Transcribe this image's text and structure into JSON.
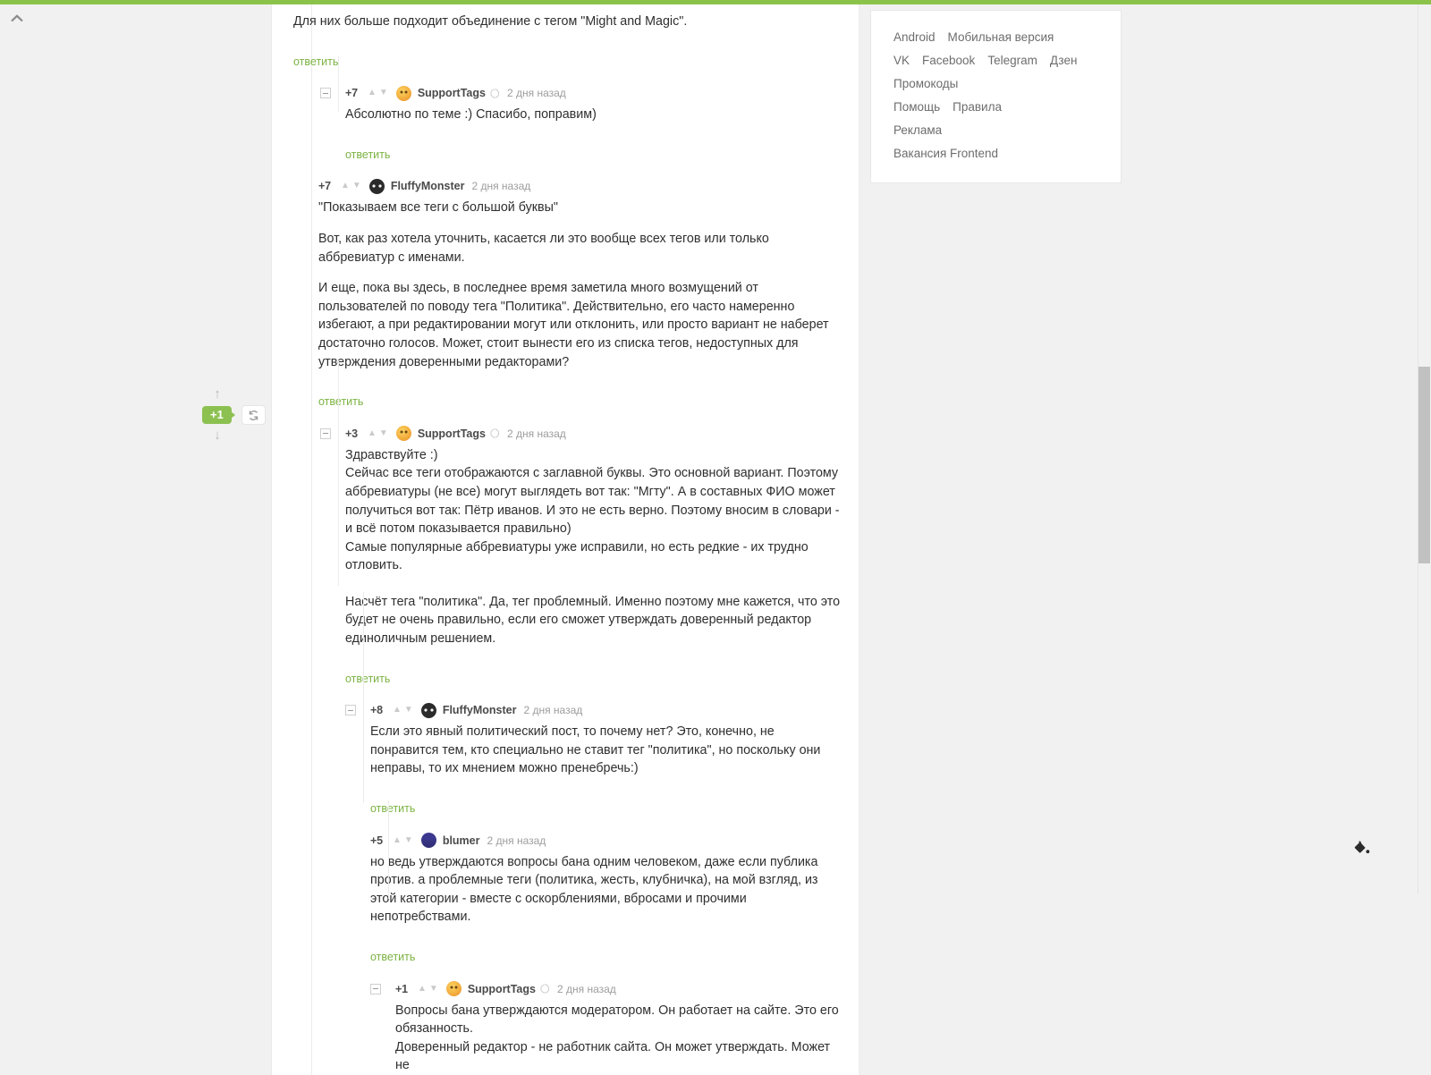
{
  "theme": {
    "accent_green": "#8bc34a",
    "link_green": "#7cb342",
    "page_bg": "#f1f1f1",
    "panel_bg": "#ffffff"
  },
  "float_vote": {
    "score": "+1",
    "up_arrow": "↑",
    "down_arrow": "↓"
  },
  "labels": {
    "reply": "ответить",
    "collapse": "–"
  },
  "comments": [
    {
      "id": "c0",
      "indent": 0,
      "show_head": false,
      "paragraphs": [
        "Для них больше подходит объединение с тегом \"Might and Magic\"."
      ],
      "reply": "ответить"
    },
    {
      "id": "c1",
      "indent": 1,
      "show_head": true,
      "collapser": true,
      "score": "+7",
      "author": "SupportTags",
      "avatar": "supporttags",
      "badge": "moon-badge",
      "time": "2 дня назад",
      "paragraphs": [
        "Абсолютно по теме :) Спасибо, поправим)"
      ],
      "reply": "ответить"
    },
    {
      "id": "c2",
      "indent": 0,
      "show_head": true,
      "collapser": false,
      "score": "+7",
      "author": "FluffyMonster",
      "avatar": "fluffymonster",
      "time": "2 дня назад",
      "paragraphs": [
        "\"Показываем все теги с большой буквы\"",
        "Вот, как раз хотела уточнить, касается ли это вообще всех тегов или только аббревиатур с именами.",
        "И еще, пока вы здесь, в последнее время заметила много возмущений от пользователей по поводу тега \"Политика\". Действительно, его часто намеренно избегают, а при редактировании могут или отклонить, или просто вариант не наберет достаточно голосов. Может, стоит вынести его из списка тегов, недоступных для утверждения доверенными редакторами?"
      ],
      "reply": "ответить"
    },
    {
      "id": "c3",
      "indent": 1,
      "show_head": true,
      "collapser": true,
      "score": "+3",
      "author": "SupportTags",
      "avatar": "supporttags",
      "badge": "moon-badge",
      "time": "2 дня назад",
      "tight_block": [
        "Здравствуйте :)",
        "Сейчас все теги отображаются с заглавной буквы. Это основной вариант. Поэтому аббревиатуры (не все) могут выглядеть вот так: \"Мгту\". А в составных ФИО может получиться вот так: Пётр иванов. И это не есть верно. Поэтому вносим в словари - и всё потом показывается правильно)",
        "Самые популярные аббревиатуры уже исправили, но есть редкие - их трудно отловить."
      ],
      "paragraphs": [
        "Насчёт тега \"политика\". Да, тег проблемный. Именно поэтому мне  кажется, что это будет не очень правильно, если его сможет утверждать доверенный редактор единоличным решением."
      ],
      "reply": "ответить"
    },
    {
      "id": "c4",
      "indent": 2,
      "show_head": true,
      "collapser": true,
      "score": "+8",
      "author": "FluffyMonster",
      "avatar": "fluffymonster",
      "time": "2 дня назад",
      "paragraphs": [
        "Если это явный политический пост, то почему нет? Это, конечно, не понравится тем, кто специально не ставит тег \"политика\", но поскольку они неправы, то их мнением можно пренебречь:)"
      ],
      "reply": "ответить"
    },
    {
      "id": "c5",
      "indent": 2,
      "show_head": true,
      "collapser": false,
      "score": "+5",
      "author": "blumer",
      "avatar": "blumer",
      "time": "2 дня назад",
      "paragraphs": [
        "но ведь утверждаются вопросы бана одним человеком, даже если публика против. а проблемные теги (политика, жесть, клубничка), на мой взгляд, из этой категории - вместе с оскорблениями, вбросами и прочими непотребствами."
      ],
      "reply": "ответить"
    },
    {
      "id": "c6",
      "indent": 3,
      "show_head": true,
      "collapser": true,
      "score": "+1",
      "author": "SupportTags",
      "avatar": "supporttags",
      "badge": "moon-badge",
      "time": "2 дня назад",
      "tight_block": [
        "Вопросы бана утверждаются модератором. Он работает на сайте. Это его обязанность.",
        "Доверенный редактор - не работник сайта.  Он может утверждать. Может не"
      ],
      "paragraphs": [],
      "reply": null
    }
  ],
  "sidebar": {
    "rows": [
      {
        "links": [
          "Android",
          "Мобильная версия"
        ]
      },
      {
        "links": [
          "VK",
          "Facebook",
          "Telegram",
          "Дзен"
        ]
      },
      {
        "links": [
          "Промокоды"
        ]
      },
      {
        "links": [
          "Помощь",
          "Правила"
        ]
      },
      {
        "links": [
          "Реклама"
        ]
      },
      {
        "links": [
          "Вакансия Frontend"
        ]
      }
    ]
  }
}
